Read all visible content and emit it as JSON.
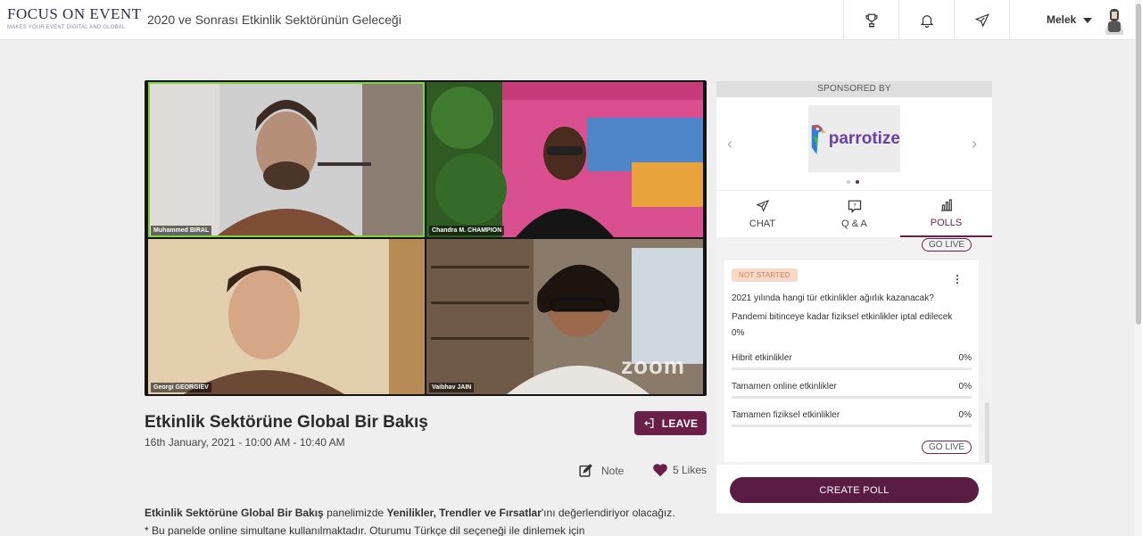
{
  "header": {
    "logo_main": "FOCUS ON EVENT",
    "logo_tagline": "MAKES YOUR EVENT DIGITAL AND GLOBAL",
    "event_title": "2020 ve Sonrası Etkinlik Sektörünün Geleceği",
    "icons": [
      "trophy-icon",
      "bell-icon",
      "send-icon"
    ],
    "user_name": "Melek"
  },
  "video": {
    "participants": [
      {
        "name": "Muhammed BIRAL",
        "active": true
      },
      {
        "name": "Chandra M. CHAMPION",
        "active": false
      },
      {
        "name": "Georgi GEORGIEV",
        "active": false
      },
      {
        "name": "Vaibhav JAIN",
        "active": false
      }
    ],
    "watermark": "zoom"
  },
  "session": {
    "title": "Etkinlik Sektörüne Global Bir Bakış",
    "date": "16th January, 2021 - 10:00 AM - 10:40 AM",
    "leave_label": "LEAVE",
    "note_label": "Note",
    "likes_label": "5 Likes",
    "desc_p1_bold1": "Etkinlik Sektörüne Global Bir Bakış",
    "desc_p1_text1": " panelimizde ",
    "desc_p1_bold2": "Yenilikler, Trendler ve Fırsatlar",
    "desc_p1_text2": "'ını değerlendiriyor olacağız.",
    "desc_p2": "* Bu panelde online simultane kullanılmaktadır. Oturumu Türkçe dil seçeneği ile dinlemek için"
  },
  "sidebar": {
    "sponsored_by": "SPONSORED BY",
    "sponsor_name": "parrotize",
    "tabs": [
      {
        "label": "CHAT",
        "icon": "send-icon"
      },
      {
        "label": "Q & A",
        "icon": "question-icon"
      },
      {
        "label": "POLLS",
        "icon": "bar-chart-icon"
      }
    ],
    "active_tab": "POLLS",
    "go_live_label": "GO LIVE",
    "poll": {
      "status": "NOT STARTED",
      "question": "2021 yılında hangi tür etkinlikler ağırlık kazanacak?",
      "options": [
        {
          "label": "Pandemi bitinceye kadar fiziksel etkinlikler iptal edilecek",
          "percent": "0%"
        },
        {
          "label": "Hibrit etkinlikler",
          "percent": "0%"
        },
        {
          "label": "Tamamen online etkinlikler",
          "percent": "0%"
        },
        {
          "label": "Tamamen fiziksel etkinlikler",
          "percent": "0%"
        }
      ]
    },
    "create_poll_label": "CREATE POLL"
  },
  "colors": {
    "accent": "#6a1f49",
    "active_speaker": "#7cd33a",
    "badge_bg": "#fbd9c8"
  }
}
